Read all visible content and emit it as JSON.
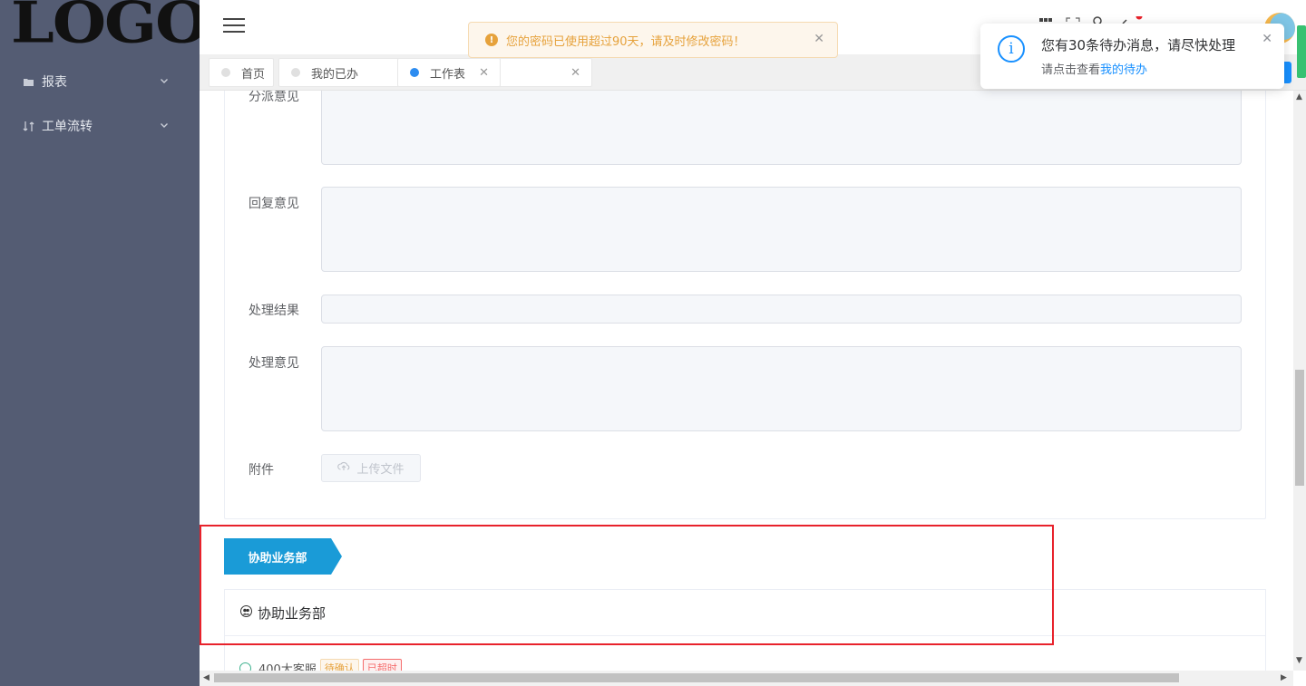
{
  "sidebar": {
    "logo_text": "LOGO",
    "items": [
      {
        "label": "报表",
        "icon": "folder-icon"
      },
      {
        "label": "工单流转",
        "icon": "workflow-icon"
      }
    ]
  },
  "header": {
    "menu_icon": "hamburger-icon",
    "icons": [
      "apps-icon",
      "fullscreen-icon",
      "search-icon",
      "bell-icon"
    ]
  },
  "tabs": [
    {
      "label": "首页",
      "active": false,
      "closable": false
    },
    {
      "label": "我的已办",
      "active": false,
      "closable": true
    },
    {
      "label": "工作表",
      "active": true,
      "closable": true
    }
  ],
  "alert": {
    "text": "您的密码已使用超过90天，请及时修改密码！",
    "icon": "warning-icon",
    "color": "#e6a23c"
  },
  "notification": {
    "title": "您有30条待办消息，请尽快处理",
    "desc_prefix": "请点击查看",
    "link_text": "我的待办",
    "icon": "info-icon",
    "color": "#1890ff"
  },
  "form": {
    "fields": [
      {
        "label": "分派意见"
      },
      {
        "label": "回复意见"
      },
      {
        "label": "处理结果"
      },
      {
        "label": "处理意见"
      },
      {
        "label": "附件"
      }
    ],
    "upload_label": "上传文件"
  },
  "section": {
    "tag_label": "协助业务部",
    "tag_color": "#1a9bd7",
    "card_title": "协助业务部",
    "row": {
      "name": "400大客服",
      "badges": [
        "待确认",
        "已超时"
      ]
    }
  },
  "highlight_color": "#e8222b"
}
